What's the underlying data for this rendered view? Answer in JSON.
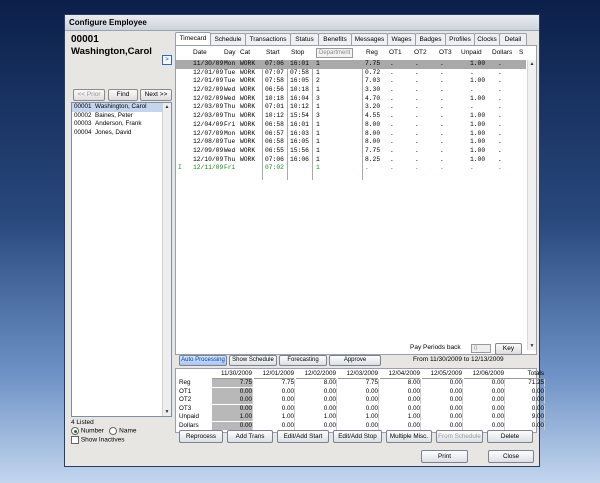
{
  "window": {
    "title": "Configure Employee"
  },
  "employee": {
    "number": "00001",
    "name": "Washington,Carol"
  },
  "nav": {
    "prior": "<< Prior",
    "find": "Find",
    "next": "Next >>"
  },
  "employees": [
    {
      "id": "00001",
      "name": "Washington, Carol"
    },
    {
      "id": "00002",
      "name": "Baines, Peter"
    },
    {
      "id": "00003",
      "name": "Anderson, Frank"
    },
    {
      "id": "00004",
      "name": "Jones, David"
    }
  ],
  "list_footer": {
    "count": "4 Listed",
    "by_number": "Number",
    "by_name": "Name",
    "show_inactives": "Show Inactives",
    "sort_selected": "Number"
  },
  "tabs": [
    "Timecard",
    "Schedule",
    "Transactions",
    "Status",
    "Benefits",
    "Messages",
    "Wages",
    "Badges",
    "Profiles",
    "Clocks",
    "Detail"
  ],
  "active_tab": "Timecard",
  "timecard": {
    "columns": [
      "Date",
      "Day",
      "Cat",
      "Start",
      "Stop",
      "Department",
      "Reg",
      "OT1",
      "OT2",
      "OT3",
      "Unpaid",
      "Dollars",
      "S"
    ],
    "rows": [
      {
        "flag": "",
        "date": "11/30/09",
        "day": "Mon",
        "cat": "WORK",
        "start": "07:06",
        "stop": "16:01",
        "dept": "1",
        "reg": "7.75",
        "ot1": ".",
        "ot2": ".",
        "ot3": ".",
        "unpaid": "1.00",
        "dollars": "."
      },
      {
        "flag": "",
        "date": "12/01/09",
        "day": "Tue",
        "cat": "WORK",
        "start": "07:07",
        "stop": "07:58",
        "dept": "1",
        "reg": "0.72",
        "ot1": ".",
        "ot2": ".",
        "ot3": ".",
        "unpaid": ".",
        "dollars": "."
      },
      {
        "flag": "",
        "date": "12/01/09",
        "day": "Tue",
        "cat": "WORK",
        "start": "07:58",
        "stop": "16:05",
        "dept": "2",
        "reg": "7.03",
        "ot1": ".",
        "ot2": ".",
        "ot3": ".",
        "unpaid": "1.00",
        "dollars": "."
      },
      {
        "flag": "",
        "date": "12/02/09",
        "day": "Wed",
        "cat": "WORK",
        "start": "06:56",
        "stop": "10:18",
        "dept": "1",
        "reg": "3.30",
        "ot1": ".",
        "ot2": ".",
        "ot3": ".",
        "unpaid": ".",
        "dollars": "."
      },
      {
        "flag": "",
        "date": "12/02/09",
        "day": "Wed",
        "cat": "WORK",
        "start": "10:18",
        "stop": "16:04",
        "dept": "3",
        "reg": "4.70",
        "ot1": ".",
        "ot2": ".",
        "ot3": ".",
        "unpaid": "1.00",
        "dollars": "."
      },
      {
        "flag": "",
        "date": "12/03/09",
        "day": "Thu",
        "cat": "WORK",
        "start": "07:01",
        "stop": "10:12",
        "dept": "1",
        "reg": "3.20",
        "ot1": ".",
        "ot2": ".",
        "ot3": ".",
        "unpaid": ".",
        "dollars": "."
      },
      {
        "flag": "",
        "date": "12/03/09",
        "day": "Thu",
        "cat": "WORK",
        "start": "10:12",
        "stop": "15:54",
        "dept": "3",
        "reg": "4.55",
        "ot1": ".",
        "ot2": ".",
        "ot3": ".",
        "unpaid": "1.00",
        "dollars": "."
      },
      {
        "flag": "",
        "date": "12/04/09",
        "day": "Fri",
        "cat": "WORK",
        "start": "06:58",
        "stop": "16:01",
        "dept": "1",
        "reg": "8.00",
        "ot1": ".",
        "ot2": ".",
        "ot3": ".",
        "unpaid": "1.00",
        "dollars": "."
      },
      {
        "flag": "",
        "date": "12/07/09",
        "day": "Mon",
        "cat": "WORK",
        "start": "06:57",
        "stop": "16:03",
        "dept": "1",
        "reg": "8.00",
        "ot1": ".",
        "ot2": ".",
        "ot3": ".",
        "unpaid": "1.00",
        "dollars": "."
      },
      {
        "flag": "",
        "date": "12/08/09",
        "day": "Tue",
        "cat": "WORK",
        "start": "06:58",
        "stop": "16:05",
        "dept": "1",
        "reg": "8.00",
        "ot1": ".",
        "ot2": ".",
        "ot3": ".",
        "unpaid": "1.00",
        "dollars": "."
      },
      {
        "flag": "",
        "date": "12/09/09",
        "day": "Wed",
        "cat": "WORK",
        "start": "06:55",
        "stop": "15:56",
        "dept": "1",
        "reg": "7.75",
        "ot1": ".",
        "ot2": ".",
        "ot3": ".",
        "unpaid": "1.00",
        "dollars": "."
      },
      {
        "flag": "",
        "date": "12/10/09",
        "day": "Thu",
        "cat": "WORK",
        "start": "07:06",
        "stop": "16:06",
        "dept": "1",
        "reg": "8.25",
        "ot1": ".",
        "ot2": ".",
        "ot3": ".",
        "unpaid": "1.00",
        "dollars": "."
      },
      {
        "flag": "I",
        "date": "12/11/09",
        "day": "Fri",
        "cat": "",
        "start": "07:02",
        "stop": "",
        "dept": "1",
        "reg": ".",
        "ot1": ".",
        "ot2": ".",
        "ot3": ".",
        "unpaid": ".",
        "dollars": "."
      }
    ]
  },
  "actions": {
    "auto_processing": "Auto Processing",
    "show_schedule": "Show Schedule",
    "forecasting": "Forecasting",
    "approve": "Approve"
  },
  "pay_periods": {
    "label": "Pay Periods back",
    "value": "0",
    "key": "Key",
    "range": "From 11/30/2009 to 12/13/2009"
  },
  "totals": {
    "headers": [
      "11/30/2009",
      "12/01/2009",
      "12/02/2009",
      "12/03/2009",
      "12/04/2009",
      "12/05/2009",
      "12/06/2009",
      "Totals"
    ],
    "rows": [
      {
        "label": "Reg",
        "values": [
          "7.75",
          "7.75",
          "8.00",
          "7.75",
          "8.00",
          "0.00",
          "0.00",
          "71.25"
        ]
      },
      {
        "label": "OT1",
        "values": [
          "0.00",
          "0.00",
          "0.00",
          "0.00",
          "0.00",
          "0.00",
          "0.00",
          "0.00"
        ]
      },
      {
        "label": "OT2",
        "values": [
          "0.00",
          "0.00",
          "0.00",
          "0.00",
          "0.00",
          "0.00",
          "0.00",
          "0.00"
        ]
      },
      {
        "label": "OT3",
        "values": [
          "0.00",
          "0.00",
          "0.00",
          "0.00",
          "0.00",
          "0.00",
          "0.00",
          "0.00"
        ]
      },
      {
        "label": "Unpaid",
        "values": [
          "1.00",
          "1.00",
          "1.00",
          "1.00",
          "1.00",
          "0.00",
          "0.00",
          "9.00"
        ]
      },
      {
        "label": "Dollars",
        "values": [
          "0.00",
          "0.00",
          "0.00",
          "0.00",
          "0.00",
          "0.00",
          "0.00",
          "0.00"
        ]
      }
    ]
  },
  "bottom_buttons": {
    "reprocess": "Reprocess",
    "add_trans": "Add Trans",
    "edit_add_start": "Edit/Add Start",
    "edit_add_stop": "Edit/Add Stop",
    "multiple_misc": "Multiple Misc.",
    "from_schedule": "From Schedule",
    "delete": "Delete"
  },
  "footer": {
    "print": "Print",
    "close": "Close"
  },
  "colors": {
    "accent": "#3569b0",
    "selected_row": "#a9a9a9",
    "pending_row": "#1a8a1a"
  }
}
